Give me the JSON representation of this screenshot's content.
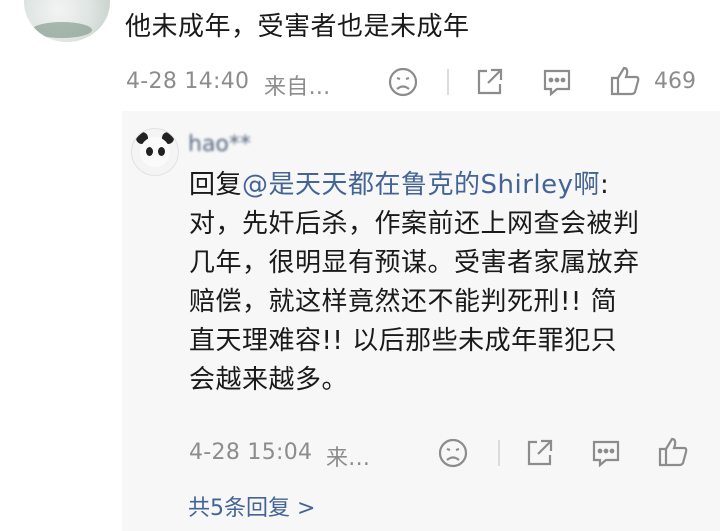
{
  "top_comment": {
    "text": "他未成年，受害者也是未成年",
    "time": "4-28 14:40",
    "source": "来自...",
    "like_count": "469",
    "icons": [
      "dislike-icon",
      "share-icon",
      "comment-icon",
      "like-icon"
    ]
  },
  "reply": {
    "username": "hao**",
    "prefix": "回复",
    "mention": "@是天天都在鲁克的Shirley啊",
    "colon": ":",
    "lines": [
      "对，先奸后杀，作案前还上网查会被判",
      "几年，很明显有预谋。受害者家属放弃",
      "赔偿，就这样竟然还不能判死刑!! 简",
      "直天理难容!! 以后那些未成年罪犯只",
      "会越来越多。"
    ],
    "time": "4-28 15:04",
    "source": "来...",
    "icons": [
      "dislike-icon",
      "share-icon",
      "comment-icon",
      "like-icon"
    ]
  },
  "more_replies": "共5条回复 >",
  "colors": {
    "link": "#456496",
    "text": "#1a1a1a",
    "meta": "#8c8c8c",
    "reply_bg": "#f7f7f7"
  }
}
